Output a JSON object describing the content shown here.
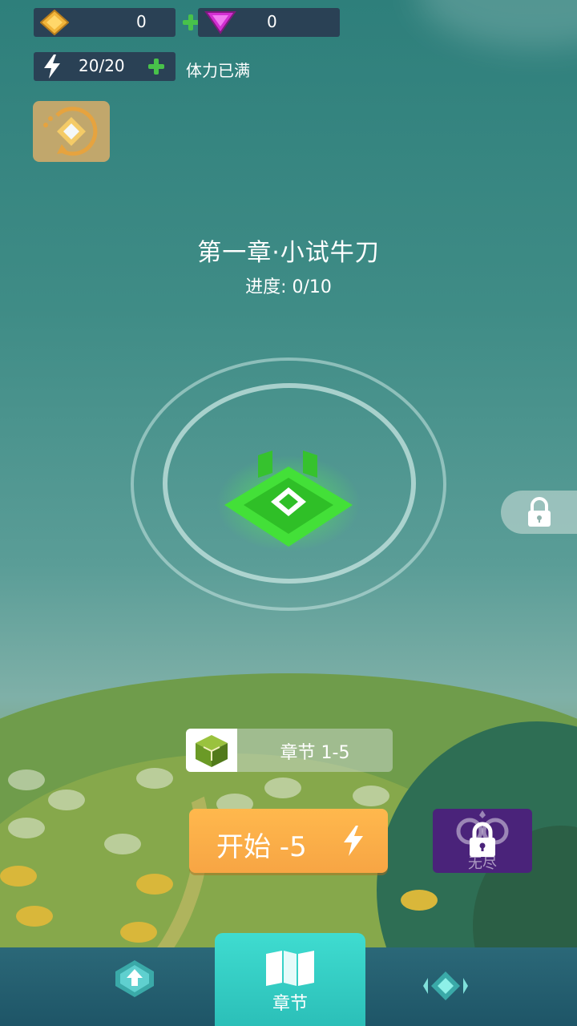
{
  "resources": {
    "gold": "0",
    "gems": "0",
    "stamina": "20/20",
    "stamina_status": "体力已满"
  },
  "chapter": {
    "title": "第一章·小试牛刀",
    "progress": "进度: 0/10",
    "tag": "章节 1-5"
  },
  "actions": {
    "start_label": "开始  -5",
    "endless_label": "无尽"
  },
  "nav": {
    "active_label": "章节"
  },
  "colors": {
    "gold": "#f2b53a",
    "gem": "#d22fd2",
    "accent_green": "#48c24a",
    "level_green": "#3fe63a",
    "start_orange": "#ffb84d",
    "endless_purple": "#4a237a",
    "nav_active": "#3fdcd0"
  },
  "icons": [
    "gold-diamond-icon",
    "gem-triangle-icon",
    "lightning-icon",
    "plus-icon",
    "daily-reward-icon",
    "level-node-icon",
    "lock-icon",
    "cube-icon",
    "upgrade-icon",
    "map-icon",
    "diamond-arrows-icon"
  ]
}
